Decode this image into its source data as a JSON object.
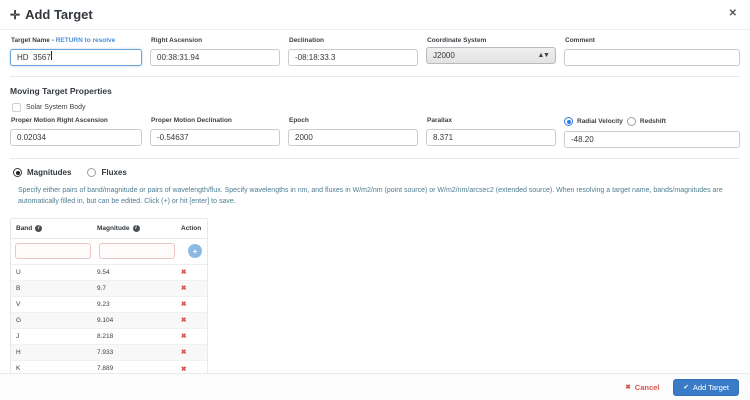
{
  "dialog": {
    "title": "Add Target"
  },
  "icons": {
    "dialog": "✛",
    "close": "✕",
    "info": "i",
    "stepper": "▲▼",
    "add": "+",
    "delete": "✖",
    "cancel": "✖",
    "confirm": "✔"
  },
  "fields": {
    "target_name": {
      "label": "Target Name -",
      "link": "RETURN to resolve",
      "value": "HD  3567"
    },
    "right_ascension": {
      "label": "Right Ascension",
      "value": "00:38:31.94"
    },
    "declination": {
      "label": "Declination",
      "value": "-08:18:33.3"
    },
    "coordinate_system": {
      "label": "Coordinate System",
      "value": "J2000"
    },
    "comment": {
      "label": "Comment",
      "value": ""
    }
  },
  "moving": {
    "heading": "Moving Target Properties",
    "solar_system_body": {
      "label": "Solar System Body",
      "checked": false
    },
    "pm_ra": {
      "label": "Proper Motion Right Ascension",
      "value": "0.02034"
    },
    "pm_dec": {
      "label": "Proper Motion Declination",
      "value": "-0.54637"
    },
    "epoch": {
      "label": "Epoch",
      "value": "2000"
    },
    "parallax": {
      "label": "Parallax",
      "value": "8.371"
    },
    "velocity": {
      "radial_label": "Radial Velocity",
      "redshift_label": "Redshift",
      "selected": "Radial Velocity",
      "value": "-48.20"
    }
  },
  "photometry": {
    "magnitudes_label": "Magnitudes",
    "fluxes_label": "Fluxes",
    "selected_mode": "Magnitudes",
    "info": "Specify either pairs of band/magnitude or pairs of wavelength/flux. Specify wavelengths in nm, and fluxes in W/m2/nm (point source) or W/m2/nm/arcsec2 (extended source). When resolving a target name, bands/magnitudes are automatically filled in, but can be edited. Click (+) or hit [enter] to save.",
    "table": {
      "headers": {
        "band": "Band",
        "magnitude": "Magnitude",
        "action": "Action"
      },
      "rows": [
        {
          "band": "U",
          "magnitude": "9.54"
        },
        {
          "band": "B",
          "magnitude": "9.7"
        },
        {
          "band": "V",
          "magnitude": "9.23"
        },
        {
          "band": "G",
          "magnitude": "9.104"
        },
        {
          "band": "J",
          "magnitude": "8.218"
        },
        {
          "band": "H",
          "magnitude": "7.933"
        },
        {
          "band": "K",
          "magnitude": "7.889"
        }
      ]
    }
  },
  "footer": {
    "cancel_label": "Cancel",
    "add_label": "Add Target"
  },
  "colors": {
    "accent_blue": "#3a7bc8",
    "link_blue": "#4a90d9",
    "danger_red": "#d9534f",
    "info_teal": "#4e7d92",
    "add_circle_blue": "#8cb9e4"
  }
}
